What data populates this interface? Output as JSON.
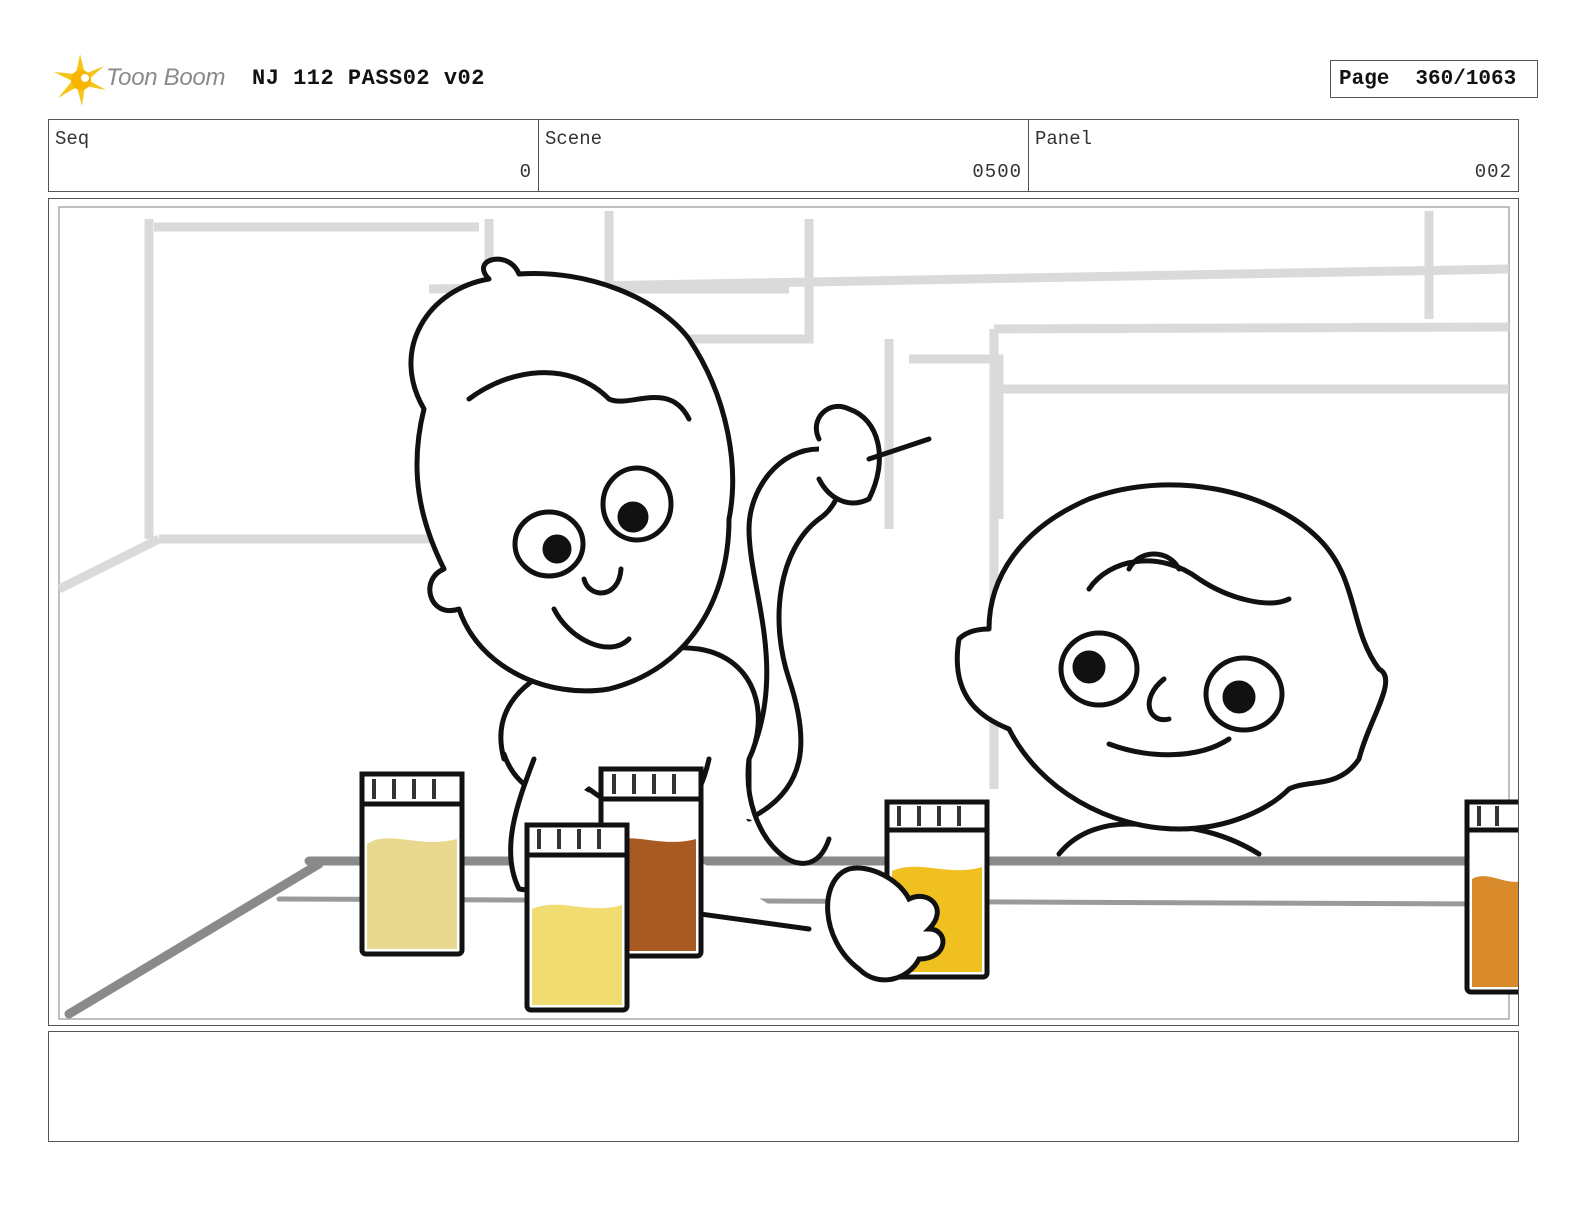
{
  "header": {
    "logo_text": "Toon Boom",
    "title": "NJ 112 PASS02 v02",
    "page_label": "Page",
    "page_value": "360/1063"
  },
  "info": {
    "seq_label": "Seq",
    "seq_value": "0",
    "scene_label": "Scene",
    "scene_value": "0500",
    "panel_label": "Panel",
    "panel_value": "002"
  },
  "colors": {
    "logo_star": "#f5c518",
    "jar_pale": "#e8d890",
    "jar_yellow": "#f0dc70",
    "jar_brown": "#a85a22",
    "jar_gold": "#f0c020",
    "jar_orange": "#d98a2a"
  },
  "notes": {
    "text": ""
  }
}
